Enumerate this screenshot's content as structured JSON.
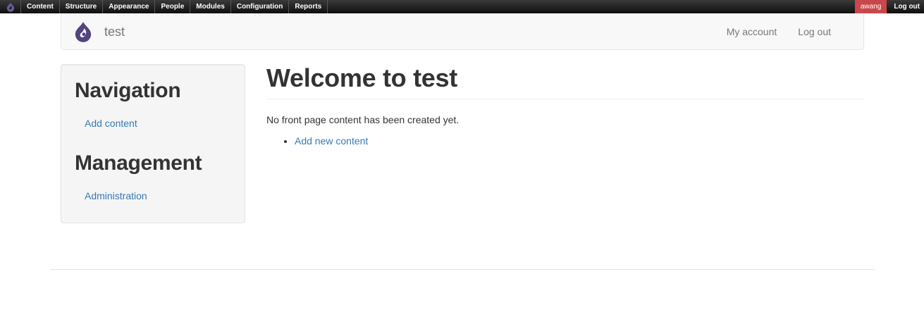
{
  "toolbar": {
    "home_icon": "drupal-drop-icon",
    "menu": [
      {
        "label": "Content"
      },
      {
        "label": "Structure"
      },
      {
        "label": "Appearance"
      },
      {
        "label": "People"
      },
      {
        "label": "Modules"
      },
      {
        "label": "Configuration"
      },
      {
        "label": "Reports"
      }
    ],
    "user_label": "awang",
    "logout_label": "Log out",
    "user_color": "#c9474a"
  },
  "header": {
    "logo_icon": "drupal-drop-icon",
    "site_name": "test",
    "links": [
      {
        "label": "My account"
      },
      {
        "label": "Log out"
      }
    ]
  },
  "sidebar": {
    "blocks": [
      {
        "title": "Navigation",
        "links": [
          {
            "label": "Add content"
          }
        ]
      },
      {
        "title": "Management",
        "links": [
          {
            "label": "Administration"
          }
        ]
      }
    ]
  },
  "main": {
    "title": "Welcome to test",
    "empty_message": "No front page content has been created yet.",
    "links": [
      {
        "label": "Add new content"
      }
    ]
  },
  "colors": {
    "link": "#337ab7",
    "logo": "#53437f"
  }
}
